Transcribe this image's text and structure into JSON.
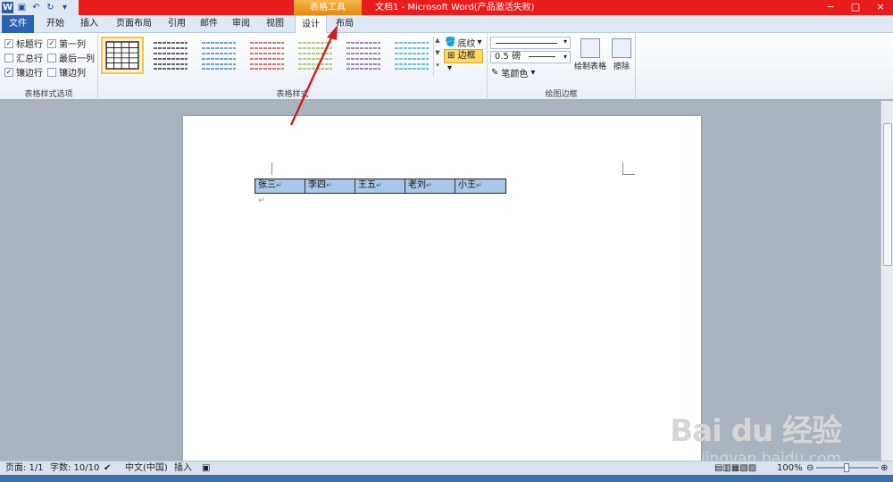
{
  "window": {
    "app_title": "文档1 - Microsoft Word(产品激活失败)",
    "context_tab_group": "表格工具",
    "controls": [
      "−",
      "□",
      "×"
    ]
  },
  "qat": {
    "icons": [
      "word-icon",
      "save-icon",
      "undo-icon",
      "redo-icon",
      "customize-icon"
    ]
  },
  "tabs": [
    {
      "label": "文件"
    },
    {
      "label": "开始"
    },
    {
      "label": "插入"
    },
    {
      "label": "页面布局"
    },
    {
      "label": "引用"
    },
    {
      "label": "邮件"
    },
    {
      "label": "审阅"
    },
    {
      "label": "视图"
    },
    {
      "label": "设计"
    },
    {
      "label": "布局"
    }
  ],
  "ribbon": {
    "style_options": {
      "label": "表格样式选项",
      "items": [
        {
          "label": "标题行",
          "checked": true
        },
        {
          "label": "第一列",
          "checked": true
        },
        {
          "label": "汇总行",
          "checked": false
        },
        {
          "label": "最后一列",
          "checked": false
        },
        {
          "label": "镶边行",
          "checked": true
        },
        {
          "label": "镶边列",
          "checked": false
        }
      ]
    },
    "table_styles": {
      "label": "表格样式",
      "swatch_colors": [
        "#222222",
        "#333333",
        "#4f81bd",
        "#c0504d",
        "#9bbb59",
        "#8064a2",
        "#4bacc6"
      ]
    },
    "shading_label": "底纹",
    "borders_label": "边框",
    "draw_borders": {
      "label": "绘图边框",
      "pen_weight": "0.5 磅",
      "pen_color": "笔颜色",
      "draw_table": "绘制表格",
      "eraser": "擦除"
    }
  },
  "document": {
    "table_cells": [
      "张三",
      "李四",
      "王五",
      "老刘",
      "小王"
    ],
    "cell_mark": "↵",
    "paragraph_mark": "↵"
  },
  "statusbar": {
    "page": "页面: 1/1",
    "words": "字数: 10/10",
    "language": "中文(中国)",
    "insert_mode": "插入",
    "zoom": "100%"
  },
  "watermark": {
    "brand": "Bai du 经验",
    "url": "jingyan.baidu.com"
  }
}
